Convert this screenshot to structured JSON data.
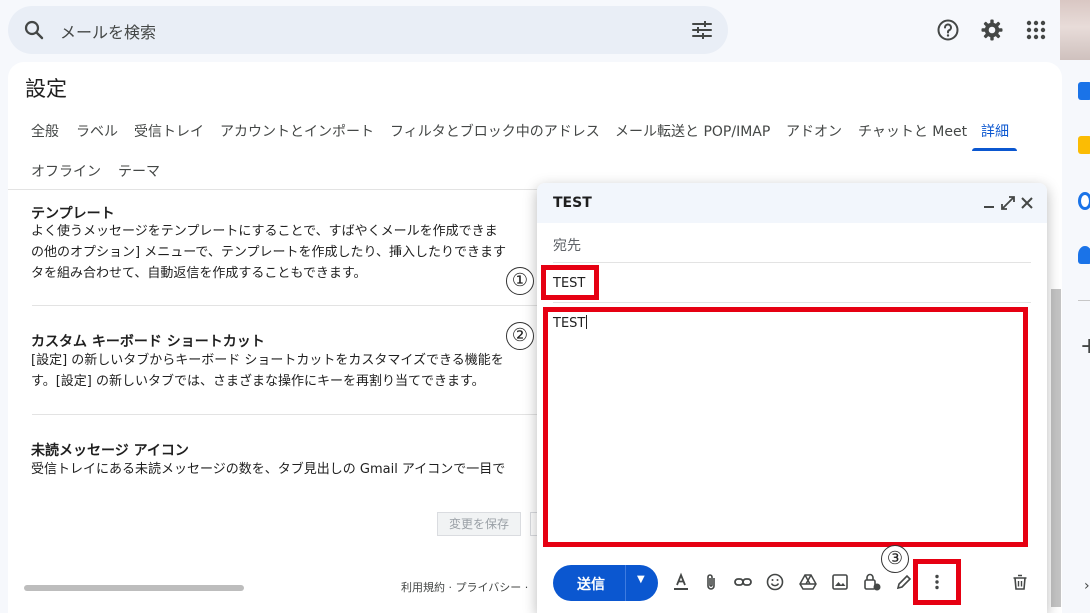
{
  "search": {
    "placeholder": "メールを検索",
    "icons": [
      "search-icon",
      "tune-icon"
    ]
  },
  "topbar": {
    "icons": [
      "help-icon",
      "gear-icon",
      "apps-grid-icon"
    ]
  },
  "settings": {
    "title": "設定",
    "tabs": [
      {
        "label": "全般",
        "active": false
      },
      {
        "label": "ラベル",
        "active": false
      },
      {
        "label": "受信トレイ",
        "active": false
      },
      {
        "label": "アカウントとインポート",
        "active": false
      },
      {
        "label": "フィルタとブロック中のアドレス",
        "active": false
      },
      {
        "label": "メール転送と POP/IMAP",
        "active": false
      },
      {
        "label": "アドオン",
        "active": false
      },
      {
        "label": "チャットと Meet",
        "active": false
      },
      {
        "label": "詳細",
        "active": true
      },
      {
        "label": "オフライン",
        "active": false
      },
      {
        "label": "テーマ",
        "active": false
      }
    ],
    "sections": [
      {
        "title": "テンプレート",
        "lines": [
          "よく使うメッセージをテンプレートにすることで、すばやくメールを作成できま",
          "の他のオプション] メニューで、テンプレートを作成したり、挿入したりできます",
          "タを組み合わせて、自動返信を作成することもできます。"
        ]
      },
      {
        "title": "カスタム キーボード ショートカット",
        "lines": [
          "[設定] の新しいタブからキーボード ショートカットをカスタマイズできる機能を",
          "す。[設定] の新しいタブでは、さまざまな操作にキーを再割り当てできます。"
        ]
      },
      {
        "title": "未読メッセージ アイコン",
        "lines": [
          "受信トレイにある未読メッセージの数を、タブ見出しの Gmail アイコンで一目で"
        ]
      }
    ],
    "save_button": "変更を保存",
    "footer": "利用規約 · プライバシー ·"
  },
  "compose": {
    "title": "TEST",
    "to_label": "宛先",
    "subject": "TEST",
    "body": "TEST",
    "send_label": "送信",
    "header_icons": [
      "minimize-icon",
      "fullscreen-icon",
      "close-icon"
    ],
    "toolbar_icons": [
      "format-text-icon",
      "attach-icon",
      "link-icon",
      "emoji-icon",
      "drive-icon",
      "photo-icon",
      "confidential-lock-icon",
      "signature-pen-icon",
      "more-options-icon",
      "trash-icon"
    ]
  },
  "annotations": {
    "markers": [
      "①",
      "②",
      "③"
    ],
    "highlight_color": "#e60012"
  },
  "colors": {
    "accent": "#0b57d0",
    "background": "#f6f8fc",
    "search_bg": "#e9eef6"
  }
}
